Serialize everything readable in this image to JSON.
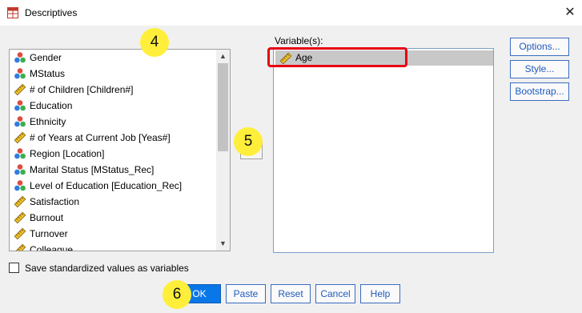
{
  "window": {
    "title": "Descriptives"
  },
  "source_list": {
    "items": [
      {
        "label": "Gender",
        "icon": "nominal-icon"
      },
      {
        "label": "MStatus",
        "icon": "nominal-icon"
      },
      {
        "label": "# of Children [Children#]",
        "icon": "scale-icon"
      },
      {
        "label": "Education",
        "icon": "nominal-icon"
      },
      {
        "label": "Ethnicity",
        "icon": "nominal-icon"
      },
      {
        "label": "# of Years at Current Job [Yeas#]",
        "icon": "scale-icon"
      },
      {
        "label": "Region [Location]",
        "icon": "nominal-icon"
      },
      {
        "label": "Marital Status [MStatus_Rec]",
        "icon": "nominal-icon"
      },
      {
        "label": "Level of Education [Education_Rec]",
        "icon": "nominal-icon"
      },
      {
        "label": "Satisfaction",
        "icon": "scale-icon"
      },
      {
        "label": "Burnout",
        "icon": "scale-icon"
      },
      {
        "label": "Turnover",
        "icon": "scale-icon"
      },
      {
        "label": "Colleague",
        "icon": "scale-icon"
      }
    ]
  },
  "variables": {
    "label": "Variable(s):",
    "items": [
      {
        "label": "Age",
        "icon": "scale-icon"
      }
    ]
  },
  "side_buttons": {
    "options": "Options...",
    "style": "Style...",
    "bootstrap": "Bootstrap..."
  },
  "checkbox": {
    "label": "Save standardized values as variables",
    "checked": false
  },
  "buttons": {
    "ok": "OK",
    "paste": "Paste",
    "reset": "Reset",
    "cancel": "Cancel",
    "help": "Help"
  },
  "annotations": {
    "step4": "4",
    "step5": "5",
    "step6": "6"
  },
  "colors": {
    "highlight_box": "#e60012",
    "badge": "#ffef3a",
    "ok_button": "#0a77e8"
  }
}
